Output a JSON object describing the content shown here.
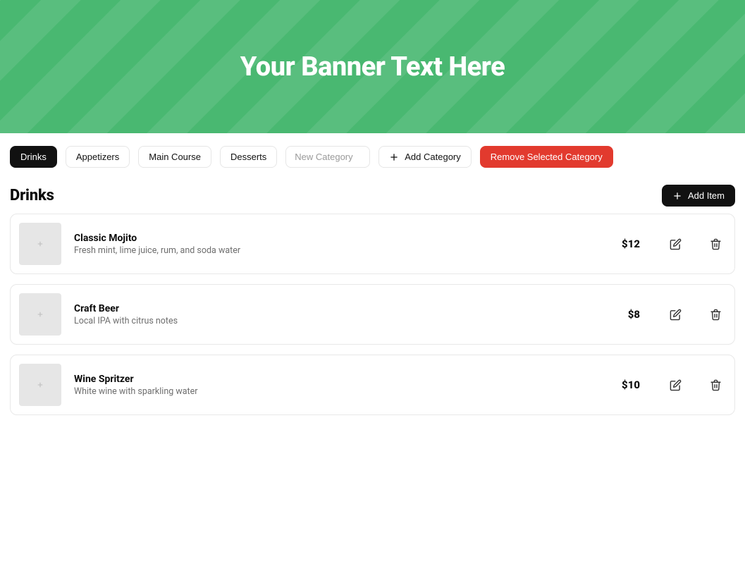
{
  "banner": {
    "text": "Your Banner Text Here"
  },
  "toolbar": {
    "tabs": [
      {
        "label": "Drinks",
        "active": true
      },
      {
        "label": "Appetizers",
        "active": false
      },
      {
        "label": "Main Course",
        "active": false
      },
      {
        "label": "Desserts",
        "active": false
      }
    ],
    "new_category_placeholder": "New Category",
    "add_category_label": "Add Category",
    "remove_category_label": "Remove Selected Category"
  },
  "section": {
    "title": "Drinks",
    "add_item_label": "Add Item"
  },
  "items": [
    {
      "name": "Classic Mojito",
      "description": "Fresh mint, lime juice, rum, and soda water",
      "price": "$12"
    },
    {
      "name": "Craft Beer",
      "description": "Local IPA with citrus notes",
      "price": "$8"
    },
    {
      "name": "Wine Spritzer",
      "description": "White wine with sparkling water",
      "price": "$10"
    }
  ]
}
